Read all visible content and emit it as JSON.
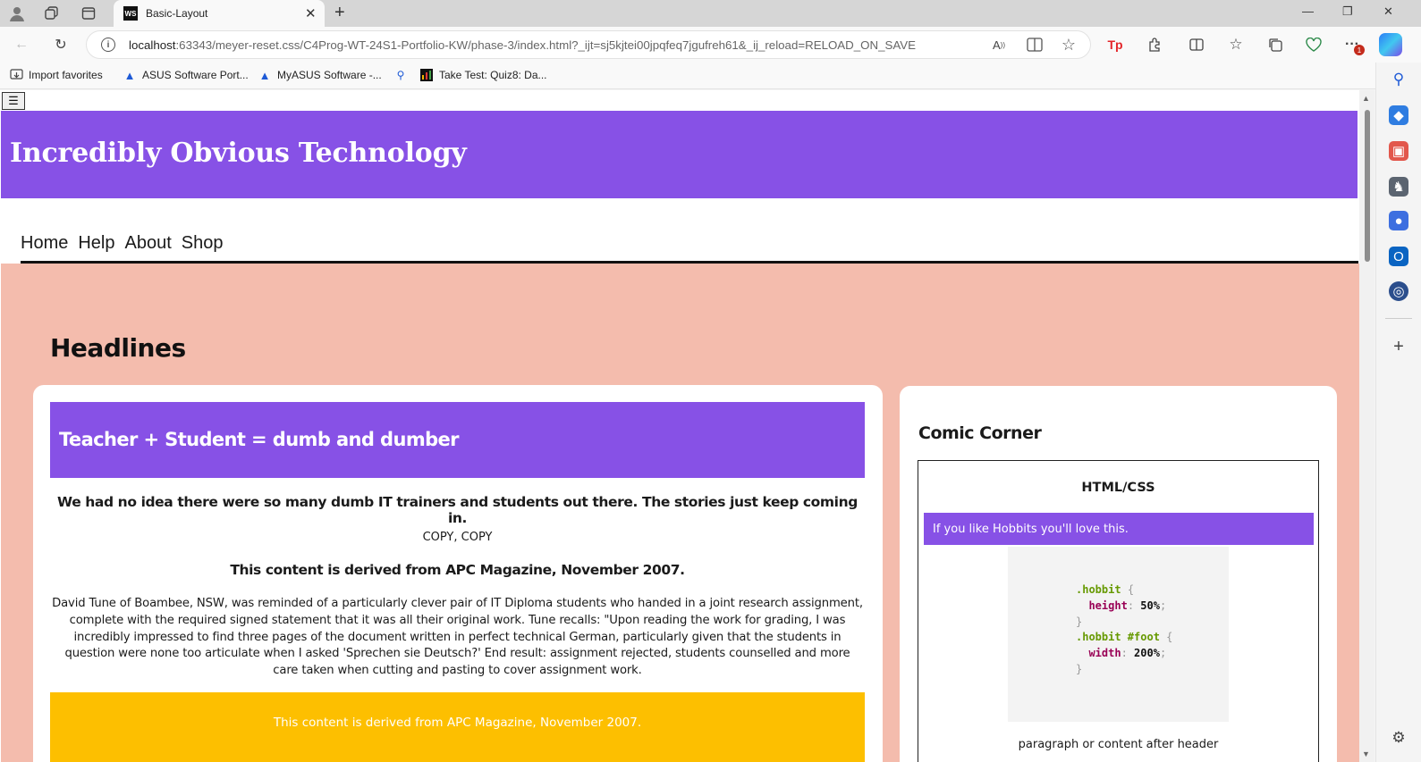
{
  "browser": {
    "tab_title": "Basic-Layout",
    "tab_favicon_text": "WS",
    "url_host": "localhost",
    "url_rest": ":63343/meyer-reset.css/C4Prog-WT-24S1-Portfolio-KW/phase-3/index.html?_ijt=sj5kjtei00jpqfeq7jgufreh61&_ij_reload=RELOAD_ON_SAVE",
    "favorites": [
      {
        "label": "Import favorites",
        "icon": "import-icon"
      },
      {
        "label": "ASUS Software Port...",
        "icon": "asus-icon"
      },
      {
        "label": "MyASUS Software -...",
        "icon": "asus-icon"
      },
      {
        "label": "",
        "icon": "search-icon"
      },
      {
        "label": "Take Test: Quiz8: Da...",
        "icon": "chart-icon"
      }
    ],
    "notification_badge": "1",
    "accent_color": "#8751e6"
  },
  "page": {
    "menu_toggle": "☰",
    "site_title": "Incredibly Obvious Technology",
    "nav": [
      "Home",
      "Help",
      "About",
      "Shop"
    ],
    "section_heading": "Headlines",
    "article": {
      "title": "Teacher + Student = dumb and dumber",
      "lead": "We had no idea there were so many dumb IT trainers and students out there. The stories just keep coming in.",
      "copy_line": "COPY, COPY",
      "source": "This content is derived from APC Magazine, November 2007.",
      "body": "David Tune of Boambee, NSW, was reminded of a particularly clever pair of IT Diploma students who handed in a joint research assignment, complete with the required signed statement that it was all their original work. Tune recalls: \"Upon reading the work for grading, I was incredibly impressed to find three pages of the document written in perfect technical German, particularly given that the students in question were none too articulate when I asked 'Sprechen sie Deutsch?' End result: assignment rejected, students counselled and more care taken when cutting and pasting to cover assignment work.",
      "footer": "This content is derived from APC Magazine, November 2007."
    },
    "comic": {
      "title": "Comic Corner",
      "subtitle": "HTML/CSS",
      "banner": "If you like Hobbits you'll love this.",
      "code": {
        "sel1": ".hobbit",
        "prop1": "height",
        "val1": "50%",
        "sel2": ".hobbit #foot",
        "prop2": "width",
        "val2": "200%"
      },
      "caption": "paragraph or content after header"
    }
  }
}
